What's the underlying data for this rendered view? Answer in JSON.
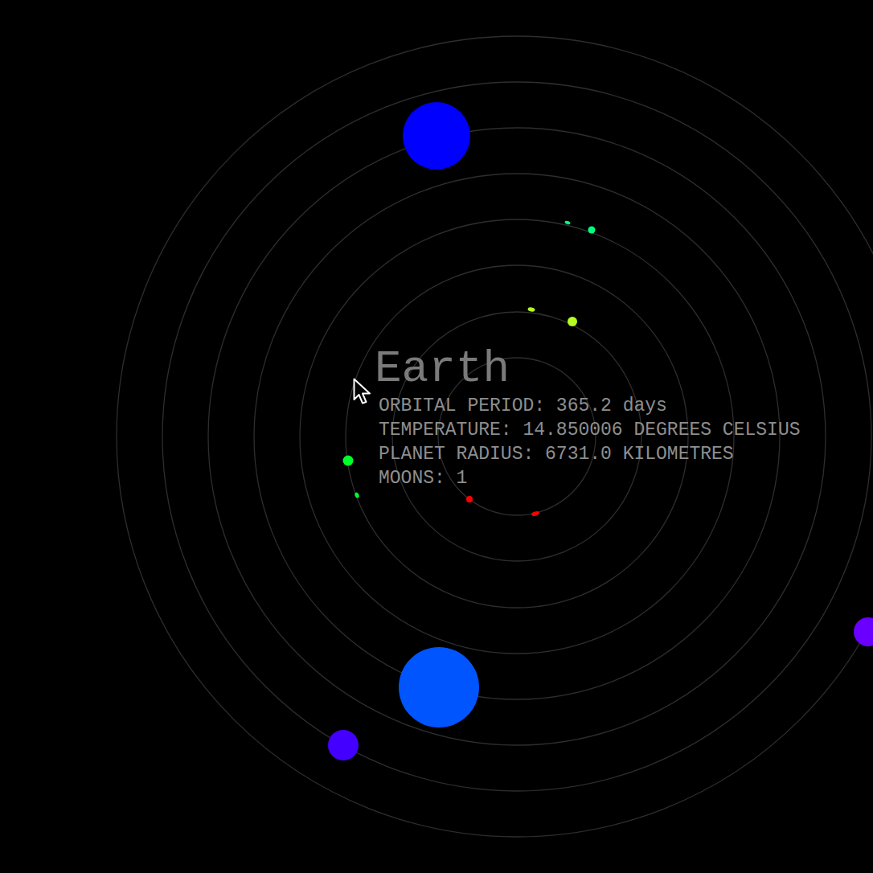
{
  "planets": [
    {
      "color": "#ff0000"
    },
    {
      "color": "#b4ff1e"
    },
    {
      "color": "#00ff2a"
    },
    {
      "color": "#00ff80"
    },
    {
      "color": "#0055ff"
    },
    {
      "color": "#0000ff"
    },
    {
      "color": "#4400ff"
    },
    {
      "color": "#6a00ff"
    }
  ],
  "tooltip": {
    "title": "Earth",
    "lines": [
      "ORBITAL PERIOD: 365.2 days",
      "TEMPERATURE: 14.850006 DEGREES CELSIUS",
      "PLANET RADIUS: 6731.0 KILOMETRES",
      "MOONS: 1"
    ]
  }
}
